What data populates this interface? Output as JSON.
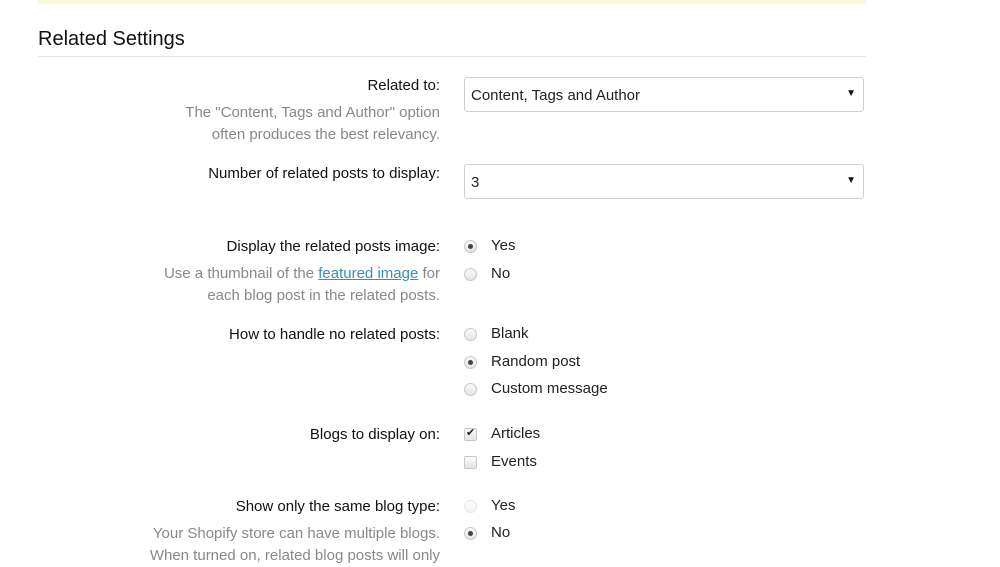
{
  "section": {
    "title": "Related Settings"
  },
  "related_to": {
    "label": "Related to:",
    "help_1": "The \"Content, Tags and Author\" option",
    "help_2": "often produces the best relevancy.",
    "value": "Content, Tags and Author",
    "arrow": "▼"
  },
  "num_posts": {
    "label": "Number of related posts to display:",
    "value": "3",
    "arrow": "▼"
  },
  "display_image": {
    "label": "Display the related posts image:",
    "help_pre": "Use a thumbnail of the ",
    "help_link": "featured image",
    "help_post": " for",
    "help_2": "each blog post in the related posts.",
    "options": [
      {
        "label": "Yes",
        "checked": true
      },
      {
        "label": "No",
        "checked": false
      }
    ]
  },
  "no_related": {
    "label": "How to handle no related posts:",
    "options": [
      {
        "label": "Blank",
        "checked": false
      },
      {
        "label": "Random post",
        "checked": true
      },
      {
        "label": "Custom message",
        "checked": false
      }
    ]
  },
  "blogs_display": {
    "label": "Blogs to display on:",
    "options": [
      {
        "label": "Articles",
        "checked": true
      },
      {
        "label": "Events",
        "checked": false
      }
    ]
  },
  "same_blog_type": {
    "label": "Show only the same blog type:",
    "help_1": "Your Shopify store can have multiple blogs.",
    "help_2": "When turned on, related blog posts will only",
    "options": [
      {
        "label": "Yes",
        "checked": false,
        "disabled": true
      },
      {
        "label": "No",
        "checked": true
      }
    ]
  }
}
